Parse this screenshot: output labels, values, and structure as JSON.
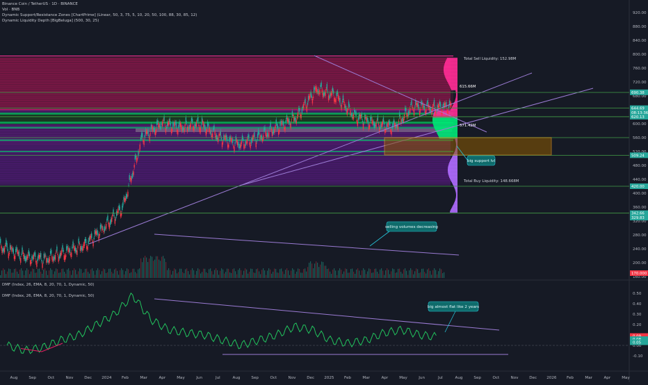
{
  "header": {
    "symbol_line": "Binance Coin / TetherUS · 1D · BINANCE",
    "vol_line": "Vol · BNB",
    "indicator1": "Dynamic Support/Resistance Zones [ChartPrime] (Linear, 50, 3, 75, 5, 10, 20, 50, 100, 88, 30, 85, 12)",
    "indicator2": "Dynamic Liquidity Depth [BigBeluga] (500, 30, 25)"
  },
  "dmf_panel": {
    "label_top": "DMF (Index, 26, EMA, 8, 20, 70, 1, Dynamic, 50)",
    "label_main": "DMF (Index, 26, EMA, 8, 20, 70, 1, Dynamic, 50)"
  },
  "annotations": {
    "total_sell": "Total Sell Liquidity: 152.98M",
    "total_buy": "Total Buy Liquidity: 148.668M",
    "poc_label": "615.66M",
    "mid_label": "571.42M",
    "big_support": "big support lvl",
    "selling_volumes": "selling volumes decreasing",
    "big_flat": "big almost flat like 2 years"
  },
  "price_axis": {
    "ticks": [
      "920.00",
      "880.00",
      "840.00",
      "800.00",
      "760.00",
      "720.00",
      "680.00",
      "640.00",
      "600.00",
      "560.00",
      "520.00",
      "480.00",
      "440.00",
      "400.00",
      "360.00",
      "320.00",
      "280.00",
      "240.00",
      "200.00",
      "160.00"
    ],
    "labels": [
      {
        "text": "690.38",
        "color": "#26a69a"
      },
      {
        "text": "644.69",
        "color": "#26a69a"
      },
      {
        "text": "08:13:36",
        "color": "#26a69a"
      },
      {
        "text": "620.13",
        "color": "#26a69a"
      },
      {
        "text": "509.24",
        "color": "#26a69a"
      },
      {
        "text": "420.00",
        "color": "#26a69a"
      },
      {
        "text": "342.66",
        "color": "#26a69a"
      },
      {
        "text": "329.83",
        "color": "#26a69a"
      },
      {
        "text": "170.000",
        "color": "#f23645"
      }
    ]
  },
  "dmf_axis": {
    "ticks": [
      "0.50",
      "0.40",
      "0.30",
      "0.20",
      "0.10",
      "0.00",
      "-0.10"
    ],
    "labels": [
      {
        "text": "0.09",
        "color": "#f23645"
      },
      {
        "text": "0.08",
        "color": "#26a69a"
      },
      {
        "text": "0.05",
        "color": "#26a69a"
      }
    ]
  },
  "time_axis": {
    "labels": [
      "Aug",
      "Sep",
      "Oct",
      "Nov",
      "Dec",
      "2024",
      "Feb",
      "Mar",
      "Apr",
      "May",
      "Jun",
      "Jul",
      "Aug",
      "Sep",
      "Oct",
      "Nov",
      "Dec",
      "2025",
      "Feb",
      "Mar",
      "Apr",
      "May",
      "Jun",
      "Jul",
      "Aug",
      "Sep",
      "Oct",
      "Nov",
      "Dec",
      "2026",
      "Feb",
      "Mar",
      "Apr",
      "May"
    ]
  },
  "colors": {
    "background": "#161a25",
    "candle_up": "#26a69a",
    "candle_down": "#f23645",
    "support_zone": "#00ff55",
    "resistance_zone": "#ff2d95",
    "liquidity_profile": "#b06cff",
    "trend_line": "#9b7bd4",
    "dmf_line": "#22c55e",
    "callout": "#0f6b6b"
  },
  "chart_data": {
    "type": "candlestick",
    "title": "Binance Coin / TetherUS · 1D · BINANCE",
    "x_range": [
      "2023-07",
      "2026-05"
    ],
    "ylim": [
      140,
      940
    ],
    "close": [
      [
        "2023-08",
        240
      ],
      [
        "2023-09",
        215
      ],
      [
        "2023-10",
        210
      ],
      [
        "2023-11",
        230
      ],
      [
        "2023-12",
        250
      ],
      [
        "2024-01",
        300
      ],
      [
        "2024-02",
        360
      ],
      [
        "2024-03",
        560
      ],
      [
        "2024-04",
        600
      ],
      [
        "2024-05",
        590
      ],
      [
        "2024-06",
        600
      ],
      [
        "2024-07",
        560
      ],
      [
        "2024-08",
        540
      ],
      [
        "2024-09",
        560
      ],
      [
        "2024-10",
        590
      ],
      [
        "2024-11",
        620
      ],
      [
        "2024-12",
        700
      ],
      [
        "2025-01",
        680
      ],
      [
        "2025-02",
        620
      ],
      [
        "2025-03",
        600
      ],
      [
        "2025-04",
        590
      ],
      [
        "2025-05",
        650
      ],
      [
        "2025-06",
        645
      ],
      [
        "2025-07",
        650
      ]
    ],
    "horizontal_levels": [
      690.38,
      644.69,
      620.13,
      509.24,
      420.0,
      342.66
    ],
    "liquidity": {
      "total_sell": "152.98M",
      "total_buy": "148.668M"
    },
    "dmf": {
      "ylim": [
        -0.15,
        0.55
      ],
      "values": [
        0.0,
        -0.05,
        -0.02,
        0.05,
        0.1,
        0.2,
        0.3,
        0.48,
        0.25,
        0.15,
        0.12,
        0.1,
        0.05,
        0.0,
        0.05,
        0.1,
        0.18,
        0.15,
        0.05,
        0.02,
        0.05,
        0.12,
        0.15,
        0.1,
        0.08
      ]
    }
  }
}
